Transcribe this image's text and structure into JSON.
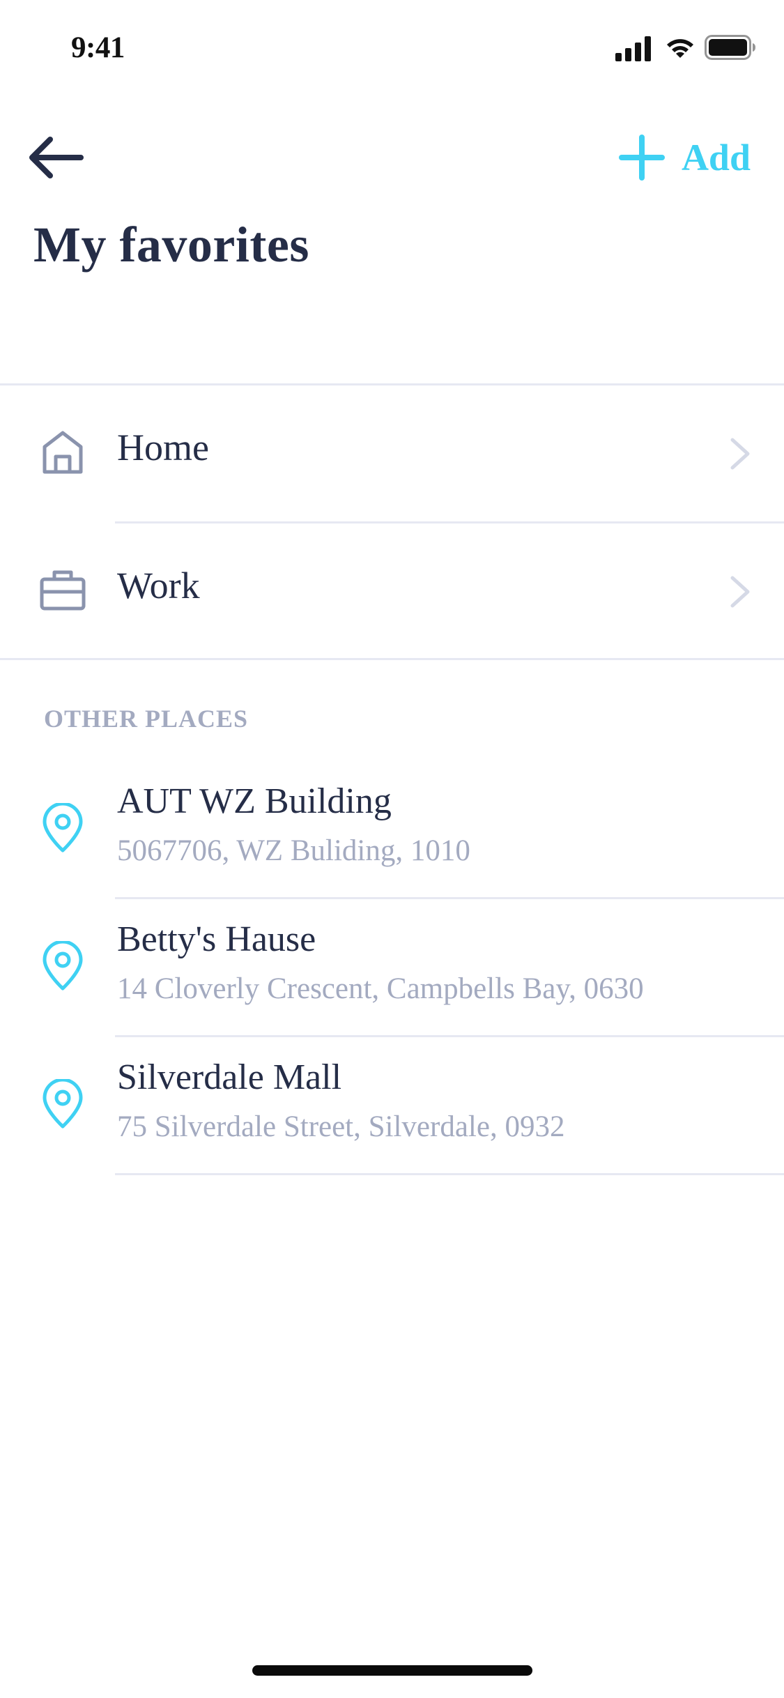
{
  "status_bar": {
    "time": "9:41",
    "icons": [
      "signal-icon",
      "wifi-icon",
      "battery-icon"
    ]
  },
  "nav": {
    "back_icon": "arrow-left-icon",
    "add_icon": "plus-icon",
    "add_label": "Add"
  },
  "title": "My favorites",
  "favorites": [
    {
      "label": "Home",
      "icon": "home-icon"
    },
    {
      "label": "Work",
      "icon": "briefcase-icon"
    }
  ],
  "other_places": {
    "header": "OTHER PLACES",
    "items": [
      {
        "name": "AUT WZ Building",
        "address": "5067706, WZ Buliding, 1010",
        "icon": "location-pin-icon"
      },
      {
        "name": "Betty's Hause",
        "address": "14 Cloverly Crescent, Campbells Bay, 0630",
        "icon": "location-pin-icon"
      },
      {
        "name": "Silverdale Mall",
        "address": "75 Silverdale Street, Silverdale, 0932",
        "icon": "location-pin-icon"
      }
    ]
  },
  "colors": {
    "accent": "#3fd1f3",
    "text_primary": "#252d47",
    "text_secondary": "#a3aac0",
    "icon_muted": "#8a93ad",
    "divider": "#e6e8f2",
    "chevron": "#d5d9e6"
  }
}
